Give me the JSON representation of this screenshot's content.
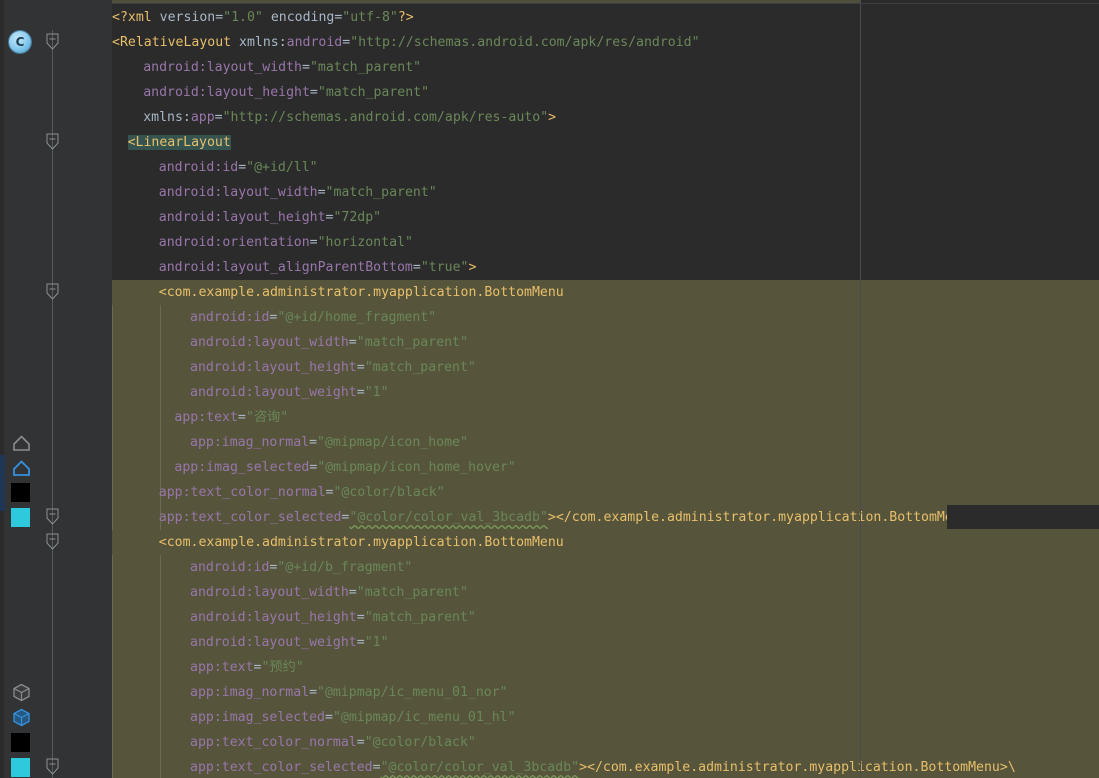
{
  "app": {
    "type": "code-editor",
    "language": "XML",
    "theme": "darcula"
  },
  "gutter": {
    "class_marker": "C",
    "resource_icons": [
      {
        "name": "home-outline-gray-icon",
        "color": "#8c8c8c"
      },
      {
        "name": "home-outline-blue-icon",
        "color": "#3592e0"
      },
      {
        "name": "black-square-icon",
        "color": "#000000"
      },
      {
        "name": "cyan-square-icon",
        "color": "#2fc9dd"
      },
      {
        "name": "cube-gray-icon",
        "color": "#8c8c8c"
      },
      {
        "name": "cube-blue-icon",
        "color": "#3592e0"
      },
      {
        "name": "black-square-icon-2",
        "color": "#000000"
      },
      {
        "name": "cyan-square-icon-2",
        "color": "#2fc9dd"
      }
    ]
  },
  "colors": {
    "background": "#2b2b2b",
    "gutter": "#313335",
    "highlight_block": "#56553c",
    "selection": "#35544f",
    "tag": "#e8bf6a",
    "attribute": "#9876aa",
    "value": "#6a8759",
    "plain": "#a9b7c6"
  },
  "code": {
    "lines": [
      {
        "n": 1,
        "indent": 0,
        "tokens": [
          {
            "t": "tag",
            "s": "<?xml"
          },
          {
            "t": "plain",
            "s": " version="
          },
          {
            "t": "val",
            "s": "\"1.0\""
          },
          {
            "t": "plain",
            "s": " encoding="
          },
          {
            "t": "val",
            "s": "\"utf-8\""
          },
          {
            "t": "tag",
            "s": "?>"
          }
        ]
      },
      {
        "n": 2,
        "indent": 0,
        "tokens": [
          {
            "t": "tag",
            "s": "<RelativeLayout"
          },
          {
            "t": "plain",
            "s": " xmlns:"
          },
          {
            "t": "attr",
            "s": "android"
          },
          {
            "t": "plain",
            "s": "="
          },
          {
            "t": "val",
            "s": "\"http://schemas.android.com/apk/res/android\""
          }
        ]
      },
      {
        "n": 3,
        "indent": 2,
        "tokens": [
          {
            "t": "attr",
            "s": "android:layout_width"
          },
          {
            "t": "plain",
            "s": "="
          },
          {
            "t": "val",
            "s": "\"match_parent\""
          }
        ]
      },
      {
        "n": 4,
        "indent": 2,
        "tokens": [
          {
            "t": "attr",
            "s": "android:layout_height"
          },
          {
            "t": "plain",
            "s": "="
          },
          {
            "t": "val",
            "s": "\"match_parent\""
          }
        ]
      },
      {
        "n": 5,
        "indent": 2,
        "tokens": [
          {
            "t": "plain",
            "s": "xmlns:"
          },
          {
            "t": "attr",
            "s": "app"
          },
          {
            "t": "plain",
            "s": "="
          },
          {
            "t": "val",
            "s": "\"http://schemas.android.com/apk/res-auto\""
          },
          {
            "t": "tag",
            "s": ">"
          }
        ]
      },
      {
        "n": 6,
        "indent": 1,
        "selected": true,
        "tokens": [
          {
            "t": "sel",
            "s": "<LinearLayout"
          }
        ]
      },
      {
        "n": 7,
        "indent": 3,
        "tokens": [
          {
            "t": "attr",
            "s": "android:id"
          },
          {
            "t": "plain",
            "s": "="
          },
          {
            "t": "val",
            "s": "\"@+id/ll\""
          }
        ]
      },
      {
        "n": 8,
        "indent": 3,
        "tokens": [
          {
            "t": "attr",
            "s": "android:layout_width"
          },
          {
            "t": "plain",
            "s": "="
          },
          {
            "t": "val",
            "s": "\"match_parent\""
          }
        ]
      },
      {
        "n": 9,
        "indent": 3,
        "tokens": [
          {
            "t": "attr",
            "s": "android:layout_height"
          },
          {
            "t": "plain",
            "s": "="
          },
          {
            "t": "val",
            "s": "\"72dp\""
          }
        ]
      },
      {
        "n": 10,
        "indent": 3,
        "tokens": [
          {
            "t": "attr",
            "s": "android:orientation"
          },
          {
            "t": "plain",
            "s": "="
          },
          {
            "t": "val",
            "s": "\"horizontal\""
          }
        ]
      },
      {
        "n": 11,
        "indent": 3,
        "tokens": [
          {
            "t": "attr",
            "s": "android:layout_alignParentBottom"
          },
          {
            "t": "plain",
            "s": "="
          },
          {
            "t": "val",
            "s": "\"true\""
          },
          {
            "t": "tag",
            "s": ">"
          }
        ]
      },
      {
        "n": 12,
        "indent": 3,
        "hl": true,
        "tokens": [
          {
            "t": "tag",
            "s": "<com.example.administrator.myapplication.BottomMenu"
          }
        ]
      },
      {
        "n": 13,
        "indent": 5,
        "hl": true,
        "tokens": [
          {
            "t": "attr",
            "s": "android:id"
          },
          {
            "t": "plain",
            "s": "="
          },
          {
            "t": "val",
            "s": "\"@+id/home_fragment\""
          }
        ]
      },
      {
        "n": 14,
        "indent": 5,
        "hl": true,
        "tokens": [
          {
            "t": "attr",
            "s": "android:layout_width"
          },
          {
            "t": "plain",
            "s": "="
          },
          {
            "t": "val",
            "s": "\"match_parent\""
          }
        ]
      },
      {
        "n": 15,
        "indent": 5,
        "hl": true,
        "tokens": [
          {
            "t": "attr",
            "s": "android:layout_height"
          },
          {
            "t": "plain",
            "s": "="
          },
          {
            "t": "val",
            "s": "\"match_parent\""
          }
        ]
      },
      {
        "n": 16,
        "indent": 5,
        "hl": true,
        "tokens": [
          {
            "t": "attr",
            "s": "android:layout_weight"
          },
          {
            "t": "plain",
            "s": "="
          },
          {
            "t": "val",
            "s": "\"1\""
          }
        ]
      },
      {
        "n": 17,
        "indent": 4,
        "hl": true,
        "tokens": [
          {
            "t": "attr",
            "s": "app:text"
          },
          {
            "t": "plain",
            "s": "="
          },
          {
            "t": "val",
            "s": "\"咨询\""
          }
        ]
      },
      {
        "n": 18,
        "indent": 5,
        "hl": true,
        "tokens": [
          {
            "t": "attr",
            "s": "app:imag_normal"
          },
          {
            "t": "plain",
            "s": "="
          },
          {
            "t": "val",
            "s": "\"@mipmap/icon_home\""
          }
        ]
      },
      {
        "n": 19,
        "indent": 4,
        "hl": true,
        "tokens": [
          {
            "t": "attr",
            "s": "app:imag_selected"
          },
          {
            "t": "plain",
            "s": "="
          },
          {
            "t": "val",
            "s": "\"@mipmap/icon_home_hover\""
          }
        ]
      },
      {
        "n": 20,
        "indent": 3,
        "hl": true,
        "tokens": [
          {
            "t": "attr",
            "s": "app:text_color_normal"
          },
          {
            "t": "plain",
            "s": "="
          },
          {
            "t": "val",
            "s": "\"@color/black\""
          }
        ]
      },
      {
        "n": 21,
        "indent": 3,
        "hl": true,
        "tokens": [
          {
            "t": "attr",
            "s": "app:text_color_selected"
          },
          {
            "t": "plain",
            "s": "="
          },
          {
            "t": "val_squiggle",
            "s": "\"@color/color_val_3bcadb\""
          },
          {
            "t": "tag",
            "s": "></com.example.administrator.myapplication.BottomMenu>"
          }
        ]
      },
      {
        "n": 22,
        "indent": 3,
        "hl": true,
        "tokens": [
          {
            "t": "tag",
            "s": "<com.example.administrator.myapplication.BottomMenu"
          }
        ]
      },
      {
        "n": 23,
        "indent": 5,
        "hl": true,
        "tokens": [
          {
            "t": "attr",
            "s": "android:id"
          },
          {
            "t": "plain",
            "s": "="
          },
          {
            "t": "val",
            "s": "\"@+id/b_fragment\""
          }
        ]
      },
      {
        "n": 24,
        "indent": 5,
        "hl": true,
        "tokens": [
          {
            "t": "attr",
            "s": "android:layout_width"
          },
          {
            "t": "plain",
            "s": "="
          },
          {
            "t": "val",
            "s": "\"match_parent\""
          }
        ]
      },
      {
        "n": 25,
        "indent": 5,
        "hl": true,
        "tokens": [
          {
            "t": "attr",
            "s": "android:layout_height"
          },
          {
            "t": "plain",
            "s": "="
          },
          {
            "t": "val",
            "s": "\"match_parent\""
          }
        ]
      },
      {
        "n": 26,
        "indent": 5,
        "hl": true,
        "tokens": [
          {
            "t": "attr",
            "s": "android:layout_weight"
          },
          {
            "t": "plain",
            "s": "="
          },
          {
            "t": "val",
            "s": "\"1\""
          }
        ]
      },
      {
        "n": 27,
        "indent": 5,
        "hl": true,
        "tokens": [
          {
            "t": "attr",
            "s": "app:text"
          },
          {
            "t": "plain",
            "s": "="
          },
          {
            "t": "val",
            "s": "\"预约\""
          }
        ]
      },
      {
        "n": 28,
        "indent": 5,
        "hl": true,
        "tokens": [
          {
            "t": "attr",
            "s": "app:imag_normal"
          },
          {
            "t": "plain",
            "s": "="
          },
          {
            "t": "val",
            "s": "\"@mipmap/ic_menu_01_nor\""
          }
        ]
      },
      {
        "n": 29,
        "indent": 5,
        "hl": true,
        "tokens": [
          {
            "t": "attr",
            "s": "app:imag_selected"
          },
          {
            "t": "plain",
            "s": "="
          },
          {
            "t": "val",
            "s": "\"@mipmap/ic_menu_01_hl\""
          }
        ]
      },
      {
        "n": 30,
        "indent": 5,
        "hl": true,
        "tokens": [
          {
            "t": "attr",
            "s": "app:text_color_normal"
          },
          {
            "t": "plain",
            "s": "="
          },
          {
            "t": "val",
            "s": "\"@color/black\""
          }
        ]
      },
      {
        "n": 31,
        "indent": 5,
        "hl": true,
        "tokens": [
          {
            "t": "attr",
            "s": "app:text_color_selected"
          },
          {
            "t": "plain",
            "s": "="
          },
          {
            "t": "val_squiggle",
            "s": "\"@color/color_val_3bcadb\""
          },
          {
            "t": "tag",
            "s": "></com.example.administrator.myapplication.BottomMenu>\\"
          }
        ]
      }
    ]
  }
}
